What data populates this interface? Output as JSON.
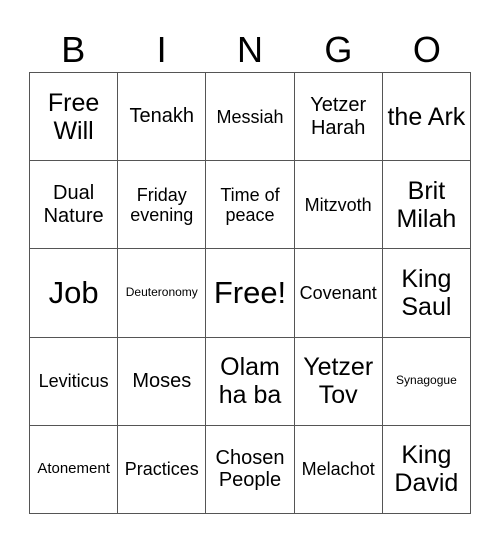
{
  "header": [
    "B",
    "I",
    "N",
    "G",
    "O"
  ],
  "cells": [
    "Free Will",
    "Tenakh",
    "Messiah",
    "Yetzer Harah",
    "the Ark",
    "Dual Nature",
    "Friday evening",
    "Time of peace",
    "Mitzvoth",
    "Brit Milah",
    "Job",
    "Deuteronomy",
    "Free!",
    "Covenant",
    "King Saul",
    "Leviticus",
    "Moses",
    "Olam ha ba",
    "Yetzer Tov",
    "Synagogue",
    "Atonement",
    "Practices",
    "Chosen People",
    "Melachot",
    "King David"
  ]
}
